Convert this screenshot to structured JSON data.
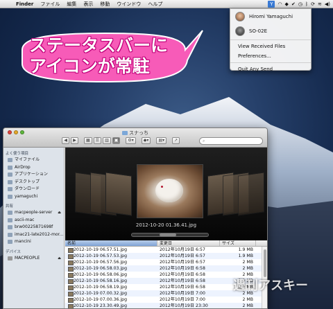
{
  "menubar": {
    "apple": "",
    "items": [
      "Finder",
      "ファイル",
      "編集",
      "表示",
      "移動",
      "ウインドウ",
      "ヘルプ"
    ],
    "app_icon": "Y"
  },
  "dropdown": {
    "users": [
      {
        "name": "Hiromi Yamaguchi",
        "avatar": "person-photo"
      },
      {
        "name": "SO-02E",
        "avatar": "device-photo"
      }
    ],
    "items": [
      "View Received Files",
      "Preferences...",
      "Quit Any Send"
    ]
  },
  "balloon": {
    "line1": "ステータスバーに",
    "line2": "アイコンが常駐",
    "color": "#f75bb8"
  },
  "finder": {
    "title": "スナっち",
    "sidebar": {
      "favorites_header": "よく使う項目",
      "favorites": [
        "マイファイル",
        "AirDrop",
        "アプリケーション",
        "デスクトップ",
        "ダウンロード",
        "yamaguchi"
      ],
      "shared_header": "共有",
      "shared": [
        "macpeople-server",
        "ascii-mac",
        "brw00225871698f",
        "imac21-late2012-mor...",
        "mancini"
      ],
      "devices_header": "デバイス",
      "devices": [
        "MACPEOPLE"
      ]
    },
    "coverflow": {
      "caption": "2012-10-20 01.36.41.jpg"
    },
    "list": {
      "headers": [
        "名前",
        "変更日",
        "サイズ"
      ],
      "rows": [
        [
          "2012-10-19 06.57.51.jpg",
          "2012年10月19日 6:57",
          "1.9 MB"
        ],
        [
          "2012-10-19 06.57.53.jpg",
          "2012年10月19日 6:57",
          "1.9 MB"
        ],
        [
          "2012-10-19 06.57.56.jpg",
          "2012年10月19日 6:57",
          "2 MB"
        ],
        [
          "2012-10-19 06.58.03.jpg",
          "2012年10月19日 6:58",
          "2 MB"
        ],
        [
          "2012-10-19 06.58.06.jpg",
          "2012年10月19日 6:58",
          "2 MB"
        ],
        [
          "2012-10-19 06.58.16.jpg",
          "2012年10月19日 6:58",
          "1.9 MB"
        ],
        [
          "2012-10-19 06.58.19.jpg",
          "2012年10月19日 6:58",
          "1.9 MB"
        ],
        [
          "2012-10-19 07.00.32.jpg",
          "2012年10月19日 7:00",
          "2 MB"
        ],
        [
          "2012-10-19 07.00.36.jpg",
          "2012年10月19日 7:00",
          "2 MB"
        ],
        [
          "2012-10-19 23.30.49.jpg",
          "2012年10月19日 23:30",
          "2 MB"
        ]
      ]
    }
  },
  "watermark": "週刊アスキー"
}
